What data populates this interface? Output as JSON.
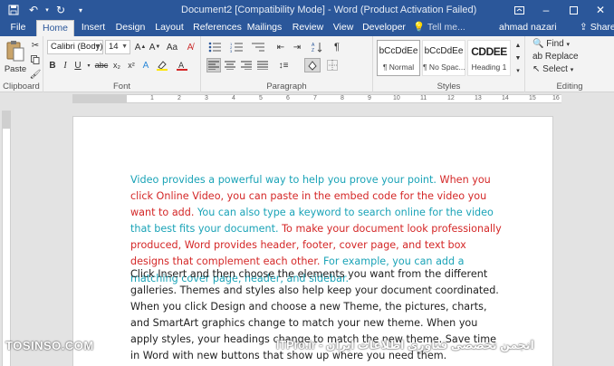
{
  "window": {
    "title": "Document2 [Compatibility Mode] - Word (Product Activation Failed)"
  },
  "quick_access": {
    "icons": [
      "save-icon",
      "undo-icon",
      "redo-icon",
      "customize-icon"
    ]
  },
  "tabs": [
    "File",
    "Home",
    "Insert",
    "Design",
    "Layout",
    "References",
    "Mailings",
    "Review",
    "View",
    "Developer"
  ],
  "active_tab": "Home",
  "tell_me": "Tell me...",
  "user_name": "ahmad nazari",
  "share_label": "Share",
  "ribbon": {
    "clipboard": {
      "label": "Clipboard",
      "paste_label": "Paste"
    },
    "font": {
      "label": "Font",
      "font_name": "Calibri (Body)",
      "font_size": "14"
    },
    "paragraph": {
      "label": "Paragraph"
    },
    "styles": {
      "label": "Styles",
      "items": [
        {
          "sample": "bCcDdEe",
          "name": "¶ Normal"
        },
        {
          "sample": "bCcDdEe",
          "name": "¶ No Spac..."
        },
        {
          "sample": "CDDEE",
          "name": "Heading 1"
        }
      ]
    },
    "editing": {
      "label": "Editing",
      "find": "Find",
      "replace": "Replace",
      "select": "Select"
    }
  },
  "ruler_numbers": [
    "1",
    "2",
    "3",
    "4",
    "5",
    "6",
    "7",
    "8",
    "9",
    "10",
    "11",
    "12",
    "13",
    "14",
    "15",
    "16"
  ],
  "document": {
    "paragraph1": [
      {
        "color": "teal",
        "text": "Video provides a powerful way to help you prove your point. "
      },
      {
        "color": "red",
        "text": "When you click Online Video, you can paste in the embed code for the video you want to add. "
      },
      {
        "color": "teal",
        "text": "You can also type a keyword to search online for the video that best fits your document. "
      },
      {
        "color": "red",
        "text": "To make your document look professionally produced, Word provides header, footer, cover page, and text box designs that complement each other. "
      },
      {
        "color": "teal",
        "text": "For example, you can add a matching cover page, header, and sidebar."
      }
    ],
    "paragraph2": "Click Insert and then choose the elements you want from the different galleries. Themes and styles also help keep your document coordinated. When you click Design and choose a new Theme, the pictures, charts, and SmartArt graphics change to match your new theme. When you apply styles, your headings change to match the new theme. Save time in Word with new buttons that show up where you need them."
  },
  "watermarks": {
    "left": "TOSINSO.COM",
    "right": "ITPro.ir - انجمن تخصصی فناوری اطلاعات ایران"
  },
  "colors": {
    "brand": "#2b579a",
    "teal": "#1aa3b7",
    "red": "#d42727"
  }
}
